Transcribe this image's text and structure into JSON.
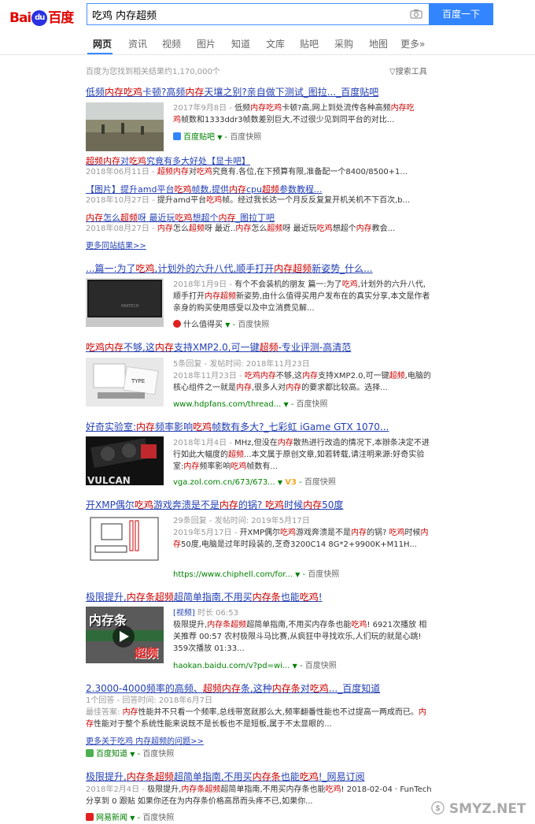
{
  "header": {
    "logo_text": "百度",
    "search_value": "吃鸡 内存超频",
    "search_button": "百度一下"
  },
  "nav": {
    "tabs": [
      "网页",
      "资讯",
      "视频",
      "图片",
      "知道",
      "文库",
      "贴吧",
      "采购",
      "地图",
      "更多»"
    ]
  },
  "stats": {
    "text": "百度为您找到相关结果约1,170,000个",
    "tools": "搜索工具"
  },
  "r1": {
    "title_a": "低频",
    "title_b": "内存吃鸡",
    "title_c": "卡顿?高频",
    "title_d": "内存",
    "title_e": "天壤之别?亲自做下测试_图拉..._百度贴吧",
    "abs_date": "2017年9月8日 - ",
    "abs_a": "低频",
    "abs_b": "内存吃鸡",
    "abs_c": "卡顿?高,网上到处流传各种高频",
    "abs_d": "内存吃",
    "abs_e": "鸡",
    "abs_f": "帧数和1333ddr3帧数差别巨大,不过很少见到同平台的对比...",
    "source": "百度贴吧",
    "kz": "百度快照",
    "subs": [
      {
        "title_a": "超频内存",
        "title_b": "对",
        "title_c": "吃鸡",
        "title_d": "究竟有多大好处【显卡吧】",
        "abs_date": "2018年06月11日 - ",
        "abs_a": "超频内存",
        "abs_b": "对",
        "abs_c": "吃鸡",
        "abs_d": "究竟有.各位,在下预算有限,准备配一个8400/8500+1..."
      },
      {
        "title_a": "【图片】提升amd平台",
        "title_b": "吃鸡",
        "title_c": "帧数,提供",
        "title_d": "内存",
        "title_e": "cpu",
        "title_f": "超频",
        "title_g": "参数教程...",
        "abs_date": "2018年10月27日 - ",
        "abs_a": "提升amd平台",
        "abs_b": "吃鸡",
        "abs_c": "帧。经过我长达一个月反反复复开机关机不下百次,b..."
      },
      {
        "title_a": "内存",
        "title_b": "怎么",
        "title_c": "超频",
        "title_d": "呀 最近玩",
        "title_e": "吃鸡",
        "title_f": "想超个",
        "title_g": "内存",
        "title_h": "_图拉丁吧",
        "abs_date": "2018年08月27日 - ",
        "abs_a": "内存",
        "abs_b": "怎么",
        "abs_c": "超频",
        "abs_d": "呀 最近..",
        "abs_e": "内存",
        "abs_f": "怎么",
        "abs_g": "超频",
        "abs_h": "呀 最近玩",
        "abs_i": "吃鸡",
        "abs_j": "想超个",
        "abs_k": "内存",
        "abs_l": "教会..."
      }
    ],
    "more": "更多同站结果>>"
  },
  "r2": {
    "title_a": "...篇一:为了",
    "title_b": "吃鸡",
    "title_c": ",计划外的六升八代,顺手打开",
    "title_d": "内存超频",
    "title_e": "新姿势_什么...",
    "abs_date": "2018年1月9日 - ",
    "abs_a": "有个不会装机的朋友 篇一:为了",
    "abs_b": "吃鸡",
    "abs_c": ",计划外的六升八代,顺手打开",
    "abs_d": "内存超频",
    "abs_e": "新姿势,由什么值得买用户发布在的真实分享,本文是作者亲身的购买使用感受以及中立消费见解...",
    "source": "什么值得买",
    "kz": "百度快照"
  },
  "r3": {
    "title_a": "吃鸡内存",
    "title_b": "不够,这",
    "title_c": "内存",
    "title_d": "支持XMP2.0,可一键",
    "title_e": "超频",
    "title_f": "-专业评测-高清范",
    "meta": "5条回复 - 发帖时间: 2018年11月23日",
    "abs_date": "2018年11月23日 - ",
    "abs_a": "吃鸡内存",
    "abs_b": "不够,这",
    "abs_c": "内存",
    "abs_d": "支持XMP2.0,可一键",
    "abs_e": "超频",
    "abs_f": ",电脑的核心组件之一就是",
    "abs_g": "内存",
    "abs_h": ",很多人对",
    "abs_i": "内存",
    "abs_j": "的要求都比较高。选择...",
    "source": "www.hdpfans.com/thread...",
    "kz": "百度快照"
  },
  "r4": {
    "title_a": "好奇实验室:",
    "title_b": "内存",
    "title_c": "频率影响",
    "title_d": "吃鸡",
    "title_e": "帧数有多大?_七彩虹 iGame GTX 1070...",
    "abs_date": "2018年1月4日 - ",
    "abs_a": "MHz,但没在",
    "abs_b": "内存",
    "abs_c": "散热进行改造的情况下,本辦条决定不进行如此大幅度的",
    "abs_d": "超频",
    "abs_e": "...本文属于原创文章,如若转载,请注明来源:好奇实验室:",
    "abs_f": "内存",
    "abs_g": "频率影响",
    "abs_h": "吃鸡",
    "abs_i": "帧数有...",
    "source": "vga.zol.com.cn/673/673...",
    "v3": "V3",
    "kz": "百度快照"
  },
  "r5": {
    "title_a": "开XMP偶尔",
    "title_b": "吃鸡",
    "title_c": "游戏奔溃是不是",
    "title_d": "内存",
    "title_e": "的锅? ",
    "title_f": "吃鸡",
    "title_g": "时候",
    "title_h": "内存",
    "title_i": "50度",
    "meta": "29条回复 - 发帖时间: 2019年5月17日",
    "abs_date": "2019年5月17日 - ",
    "abs_a": "开XMP偶尔",
    "abs_b": "吃鸡",
    "abs_c": "游戏奔溃是不是",
    "abs_d": "内存",
    "abs_e": "的锅? ",
    "abs_f": "吃鸡",
    "abs_g": "时候",
    "abs_h": "内存",
    "abs_i": "50度,电脑是过年时段装的,芝奇3200C14 8G*2+9900K+M11H...",
    "source": "https://www.chiphell.com/for...",
    "kz": "百度快照"
  },
  "r6": {
    "title_a": "极限提升,",
    "title_b": "内存条超频",
    "title_c": "超简单指南,不用买",
    "title_d": "内存条",
    "title_e": "也能",
    "title_f": "吃鸡",
    "title_g": "!",
    "tag": "[视频]",
    "dur": " 时长 06:53",
    "abs_a": "极限提升,",
    "abs_b": "内存条超频",
    "abs_c": "超简单指南,不用买内存条也能",
    "abs_d": "吃鸡",
    "abs_e": "! 6921次播放 相关推荐 00:57 农村极限斗马比赛,从疯狂中寻找欢乐,人们玩的就是心跳! 359次播放 01:33...",
    "thumb_top": "内存条",
    "thumb_bot": "超频",
    "source": "haokan.baidu.com/v?pd=wi...",
    "kz": "百度快照"
  },
  "r7": {
    "title_a": "2.3000-4000频率的高频、",
    "title_b": "超频内存",
    "title_c": "条,这种",
    "title_d": "内存条",
    "title_e": "对",
    "title_f": "吃鸡",
    "title_g": "..._百度知道",
    "meta": "1个回答 - 回答时间: 2018年6月7日",
    "abs_a": "最佳答案: ",
    "abs_b": "内存",
    "abs_c": "性能并不只看一个频率,总线带宽就那么大,频率翻番性能也不过提高一两成而已。",
    "abs_d": "内存",
    "abs_e": "性能对于整个系统性能来说既不是长板也不是短板,属于不太显眼的...",
    "more": "更多关于吃鸡 内存超频的问题>>",
    "source": "百度知道",
    "kz": "百度快照"
  },
  "r8": {
    "title_a": "极限提升,",
    "title_b": "内存条超频",
    "title_c": "超简单指南,不用买",
    "title_d": "内存条",
    "title_e": "也能",
    "title_f": "吃鸡",
    "title_g": "!_网易订阅",
    "abs_date": "2018年2月4日 - ",
    "abs_a": "极限提升,",
    "abs_b": "内存条超频",
    "abs_c": "超简单指南,不用买内存条也能",
    "abs_d": "吃鸡",
    "abs_e": "! 2018-02-04 · FunTech 分享到 0 跟贴 如果你还在为内存条价格高昂而头疼不已,如果你...",
    "source": "网易新闻",
    "kz": "百度快照"
  },
  "watermark": "SMYZ.NET",
  "colors": {
    "link": "#2440b3",
    "em": "#c00",
    "green": "#008000",
    "button": "#3385ff"
  }
}
